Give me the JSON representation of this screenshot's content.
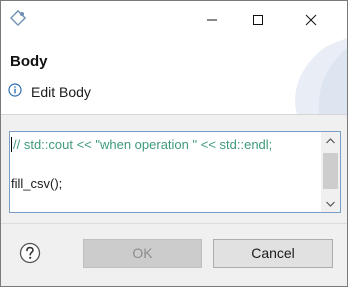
{
  "dialog": {
    "title": "Body",
    "message": "Edit Body"
  },
  "editor": {
    "lines": [
      "// std::cout << \"when operation \" << std::endl;",
      "fill_csv();"
    ],
    "comment_color": "#3f9b7a"
  },
  "buttons": {
    "ok_label": "OK",
    "ok_enabled": false,
    "cancel_label": "Cancel"
  },
  "icons": {
    "app": "eclipse-dialog-icon",
    "info": "info-icon",
    "help": "help-icon"
  }
}
